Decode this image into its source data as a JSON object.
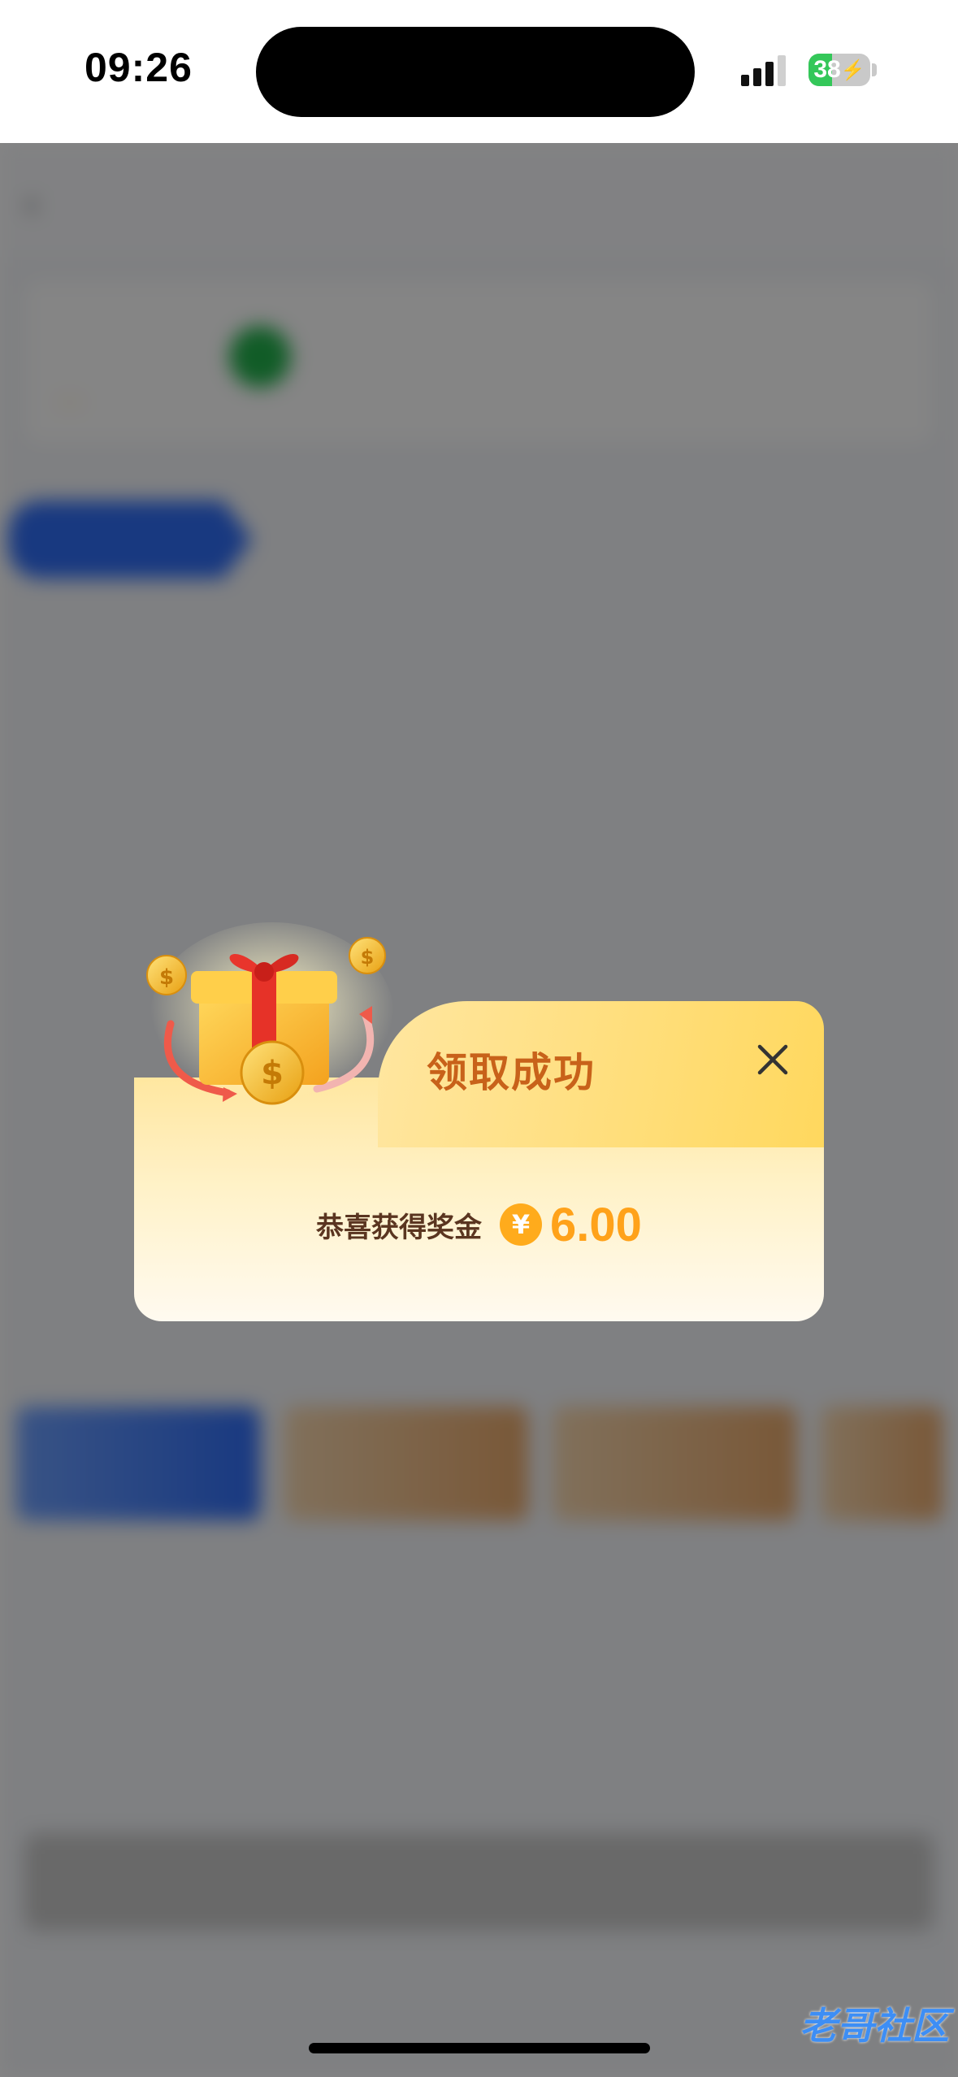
{
  "status_bar": {
    "time": "09:26",
    "battery": "38",
    "battery_level": 0.38
  },
  "background_page": {
    "title": "",
    "rule_link": "",
    "card_text": "",
    "badge": "",
    "section_tag": "",
    "paragraphs": [
      "",
      "",
      "",
      "",
      "",
      "",
      ""
    ],
    "bottom_button": ""
  },
  "popup": {
    "title": "领取成功",
    "reward_label": "恭喜获得奖金",
    "currency_symbol": "¥",
    "amount": "6.00"
  },
  "watermark": {
    "text": "老哥社区"
  },
  "colors": {
    "title": "#c8621a",
    "amount": "#ffa21a",
    "close": "#333333"
  }
}
